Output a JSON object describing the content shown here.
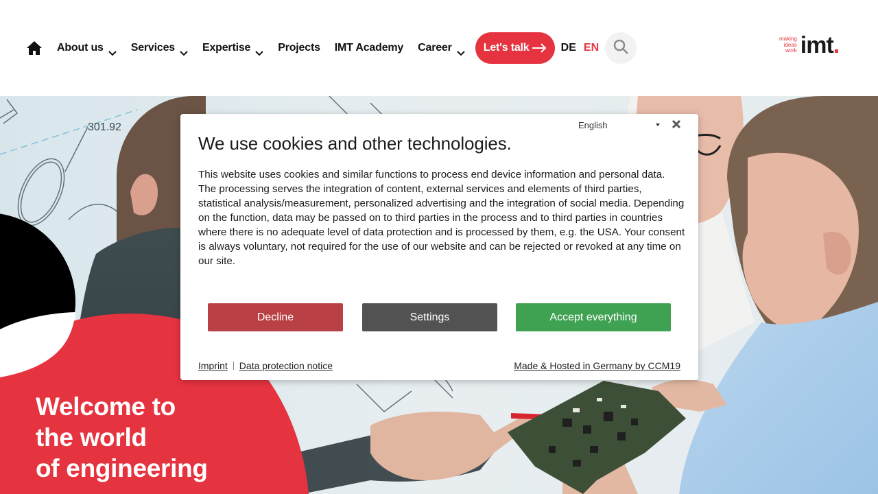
{
  "header": {
    "nav": [
      {
        "label": "About us",
        "has_dropdown": true
      },
      {
        "label": "Services",
        "has_dropdown": true
      },
      {
        "label": "Expertise",
        "has_dropdown": true
      },
      {
        "label": "Projects",
        "has_dropdown": false
      },
      {
        "label": "IMT Academy",
        "has_dropdown": false
      },
      {
        "label": "Career",
        "has_dropdown": true
      }
    ],
    "cta_label": "Let's talk",
    "languages": {
      "de": "DE",
      "en": "EN",
      "active": "EN"
    },
    "icons": {
      "home": "home-icon",
      "search": "search-icon",
      "cta_arrow": "arrow-right-icon",
      "dropdown": "chevron-down-icon"
    },
    "logo": {
      "tagline_1": "making",
      "tagline_2": "ideas",
      "tagline_3": "work",
      "word": "imt",
      "dot": "."
    }
  },
  "hero": {
    "title_line_1": "Welcome to",
    "title_line_2": "the world",
    "title_line_3": "of engineering",
    "drawing_label": "301.92"
  },
  "cookie_dialog": {
    "language_select": "English",
    "title": "We use cookies and other technologies.",
    "body": "This website uses cookies and similar functions to process end device information and personal data. The processing serves the integration of content, external services and elements of third parties, statistical analysis/measurement, personalized advertising and the integration of social media. Depending on the function, data may be passed on to third parties in the process and to third parties in countries where there is no adequate level of data protection and is processed by them, e.g. the USA. Your consent is always voluntary, not required for the use of our website and can be rejected or revoked at any time on our site.",
    "buttons": {
      "decline": "Decline",
      "settings": "Settings",
      "accept": "Accept everything"
    },
    "footer": {
      "imprint": "Imprint",
      "data_protection": "Data protection notice",
      "credit": "Made & Hosted in Germany by CCM19"
    }
  },
  "colors": {
    "brand_red": "#e63340",
    "decline": "#b94045",
    "settings": "#525252",
    "accept": "#3fa252",
    "search_bg": "#f2f2f2"
  }
}
